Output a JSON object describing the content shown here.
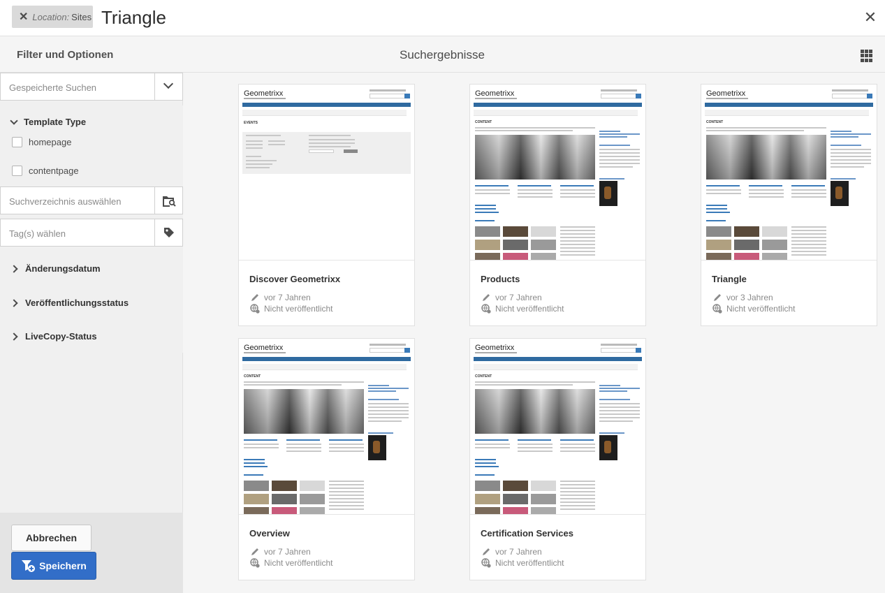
{
  "topbar": {
    "chip_location_label": "Location:",
    "chip_location_value": "Sites",
    "query": "Triangle",
    "close_glyph": "✕"
  },
  "subheader": {
    "filter_title": "Filter und Optionen",
    "results_title": "Suchergebnisse"
  },
  "filters": {
    "saved_search_placeholder": "Gespeicherte Suchen",
    "template_type": {
      "label": "Template Type",
      "options": [
        "homepage",
        "contentpage"
      ]
    },
    "path_placeholder": "Suchverzeichnis auswählen",
    "tags_placeholder": "Tag(s) wählen",
    "accordions": [
      "Änderungsdatum",
      "Veröffentlichungsstatus",
      "LiveCopy-Status"
    ],
    "cancel_label": "Abbrechen",
    "save_label": "Speichern"
  },
  "thumbnail": {
    "logo_text": "Geometrixx",
    "events_heading": "EVENTS",
    "content_heading": "CONTENT"
  },
  "results": [
    {
      "title": "Discover Geometrixx",
      "modified": "vor 7 Jahren",
      "status": "Nicht veröffentlicht",
      "variant": "events"
    },
    {
      "title": "Products",
      "modified": "vor 7 Jahren",
      "status": "Nicht veröffentlicht",
      "variant": "content"
    },
    {
      "title": "Triangle",
      "modified": "vor 3 Jahren",
      "status": "Nicht veröffentlicht",
      "variant": "content"
    },
    {
      "title": "Overview",
      "modified": "vor 7 Jahren",
      "status": "Nicht veröffentlicht",
      "variant": "content"
    },
    {
      "title": "Certification Services",
      "modified": "vor 7 Jahren",
      "status": "Nicht veröffentlicht",
      "variant": "content"
    }
  ],
  "colors": {
    "primary_button": "#326ec8",
    "nav_blue": "#2f6aa0"
  }
}
